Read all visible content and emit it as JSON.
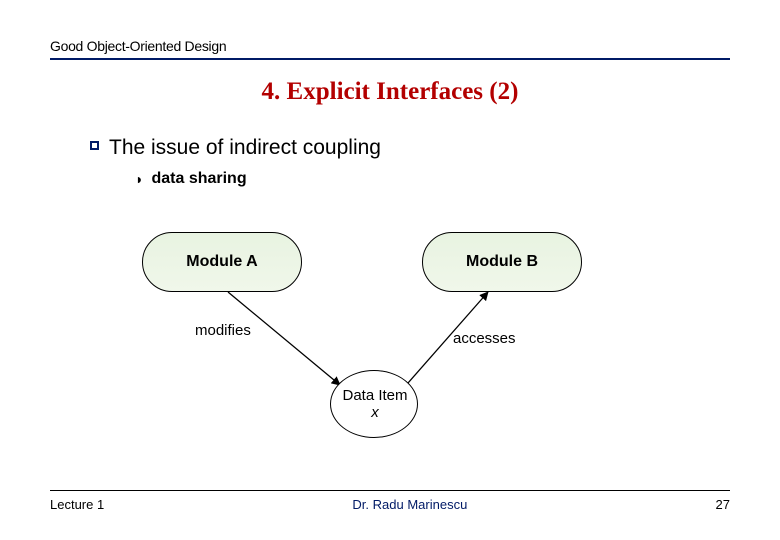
{
  "header": {
    "label": "Good Object-Oriented Design"
  },
  "title": "4. Explicit Interfaces (2)",
  "bullets": {
    "main": "The issue of indirect coupling",
    "sub": "data sharing"
  },
  "diagram": {
    "moduleA": "Module A",
    "moduleB": "Module B",
    "modifies": "modifies",
    "accesses": "accesses",
    "dataItemLine1": "Data Item",
    "dataItemLine2": "x"
  },
  "footer": {
    "left": "Lecture 1",
    "center": "Dr. Radu Marinescu",
    "right": "27"
  }
}
